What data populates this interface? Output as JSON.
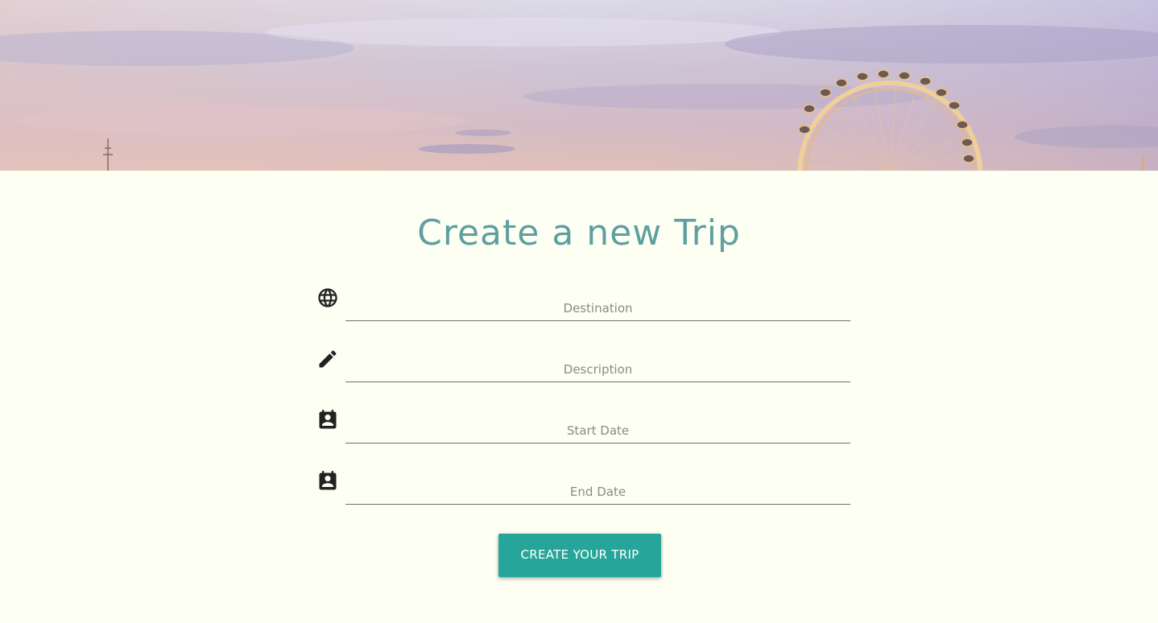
{
  "hero": {
    "image": "london-eye-sunset-sky"
  },
  "page": {
    "title": "Create a new Trip"
  },
  "form": {
    "fields": [
      {
        "icon": "globe-icon",
        "placeholder": "Destination",
        "value": ""
      },
      {
        "icon": "pencil-icon",
        "placeholder": "Description",
        "value": ""
      },
      {
        "icon": "calendar-person-icon",
        "placeholder": "Start Date",
        "value": ""
      },
      {
        "icon": "calendar-person-icon",
        "placeholder": "End Date",
        "value": ""
      }
    ],
    "submit_label": "CREATE YOUR TRIP"
  },
  "colors": {
    "background": "#fefff3",
    "title": "#5e9fa0",
    "button": "#26a69a",
    "button_text": "#ffffff",
    "icon": "#222222",
    "underline": "#6f6f6f"
  }
}
